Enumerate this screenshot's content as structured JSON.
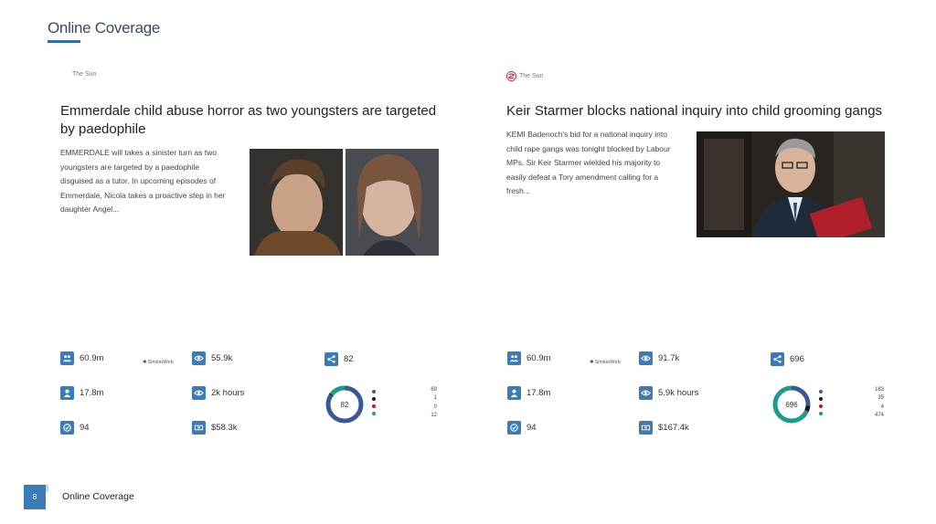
{
  "page": {
    "title": "Online Coverage",
    "footer_label": "Online Coverage",
    "page_number": "8"
  },
  "articles": [
    {
      "source": "The Sun",
      "headline": "Emmerdale child abuse horror as two youngsters are targeted by paedophile",
      "summary": "EMMERDALE will takes a sinister turn as two youngsters are targeted by a paedophile disguised as a tutor. In upcoming episodes of Emmerdale, Nicola takes a proactive step in her daughter Angel...",
      "metrics": {
        "audience": "60.9m",
        "similarweb": "SimilarWeb",
        "views": "55.9k",
        "shares": "82",
        "users": "17.8m",
        "read_time": "2k hours",
        "score": "94",
        "ave": "$58.3k",
        "donut_total": "82",
        "donut_breakdown": [
          "69",
          "1",
          "0",
          "12"
        ],
        "donut_colors": [
          "#3b5998",
          "#1a1a1a",
          "#c8102e",
          "#1b9c8e"
        ]
      }
    },
    {
      "source": "The Sun",
      "headline": "Keir Starmer blocks national inquiry into child grooming gangs",
      "summary": "KEMI Badenoch's bid for a national inquiry into child rape gangs was tonight blocked by Labour MPs. Sir Keir Starmer wielded his majority to easily defeat a Tory amendment calling for a fresh...",
      "metrics": {
        "audience": "60.9m",
        "similarweb": "SimilarWeb",
        "views": "91.7k",
        "shares": "696",
        "users": "17.8m",
        "read_time": "5.9k hours",
        "score": "94",
        "ave": "$167.4k",
        "donut_total": "696",
        "donut_breakdown": [
          "183",
          "35",
          "4",
          "474"
        ],
        "donut_colors": [
          "#3b5998",
          "#1a1a1a",
          "#c8102e",
          "#1b9c8e"
        ]
      }
    }
  ],
  "colors": {
    "accent": "#3a7bb8",
    "title": "#3a4a66"
  }
}
